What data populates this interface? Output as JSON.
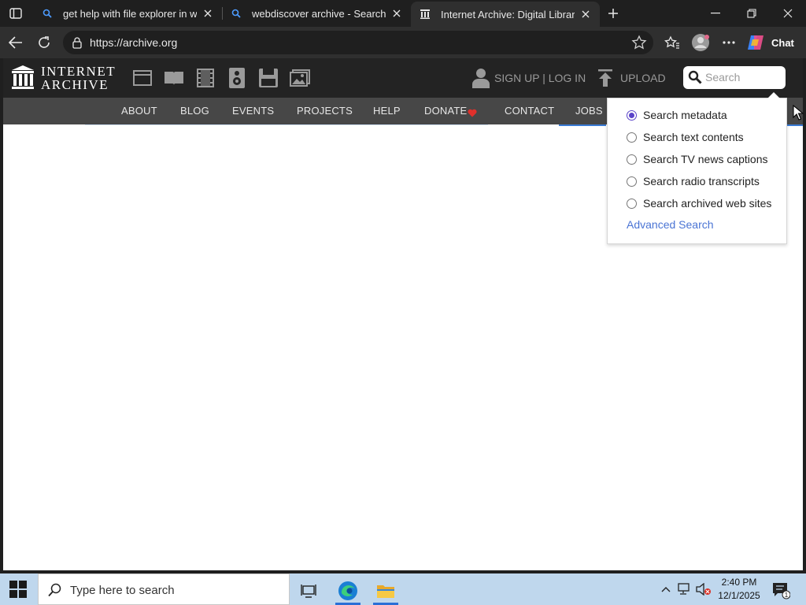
{
  "browser": {
    "tabs": [
      {
        "title": "get help with file explorer in windows",
        "active": false
      },
      {
        "title": "webdiscover archive - Search",
        "active": false
      },
      {
        "title": "Internet Archive: Digital Library of Free & Borrowable Texts",
        "active": true
      }
    ],
    "url": "https://archive.org",
    "chat_label": "Chat"
  },
  "site": {
    "logo_line1": "INTERNET",
    "logo_line2": "ARCHIVE",
    "signup_label": "SIGN UP | LOG IN",
    "upload_label": "UPLOAD",
    "search_placeholder": "Search",
    "nav": [
      "ABOUT",
      "BLOG",
      "EVENTS",
      "PROJECTS",
      "HELP",
      "DONATE",
      "CONTACT",
      "JOBS"
    ],
    "search_options": [
      {
        "label": "Search metadata",
        "checked": true
      },
      {
        "label": "Search text contents",
        "checked": false
      },
      {
        "label": "Search TV news captions",
        "checked": false
      },
      {
        "label": "Search radio transcripts",
        "checked": false
      },
      {
        "label": "Search archived web sites",
        "checked": false
      }
    ],
    "advanced_search_label": "Advanced Search"
  },
  "taskbar": {
    "search_placeholder": "Type here to search",
    "time": "2:40 PM",
    "date": "12/1/2025",
    "notification_count": "1"
  },
  "colors": {
    "ia_header": "#232323",
    "ia_nav": "#474747",
    "accent_blue": "#3a7bd5",
    "radio_selected": "#5a43c9",
    "donate_heart": "#e0302b",
    "taskbar": "#bfd7ed"
  }
}
